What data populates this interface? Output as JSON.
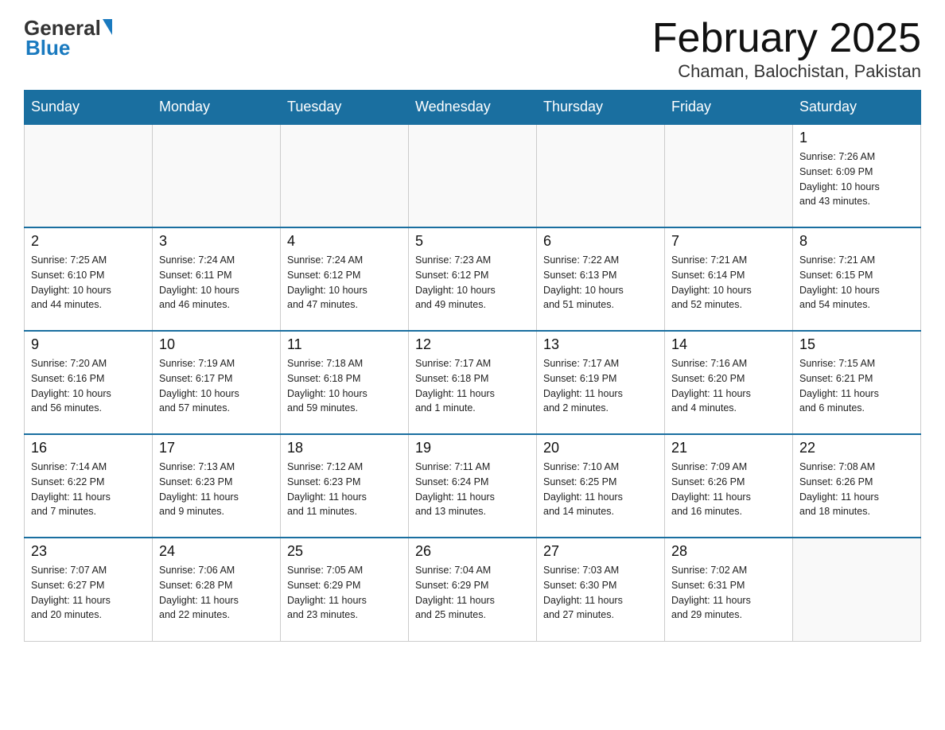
{
  "logo": {
    "text_general": "General",
    "text_blue": "Blue"
  },
  "title": {
    "month_year": "February 2025",
    "location": "Chaman, Balochistan, Pakistan"
  },
  "days_of_week": [
    "Sunday",
    "Monday",
    "Tuesday",
    "Wednesday",
    "Thursday",
    "Friday",
    "Saturday"
  ],
  "weeks": [
    [
      {
        "day": "",
        "info": "",
        "empty": true
      },
      {
        "day": "",
        "info": "",
        "empty": true
      },
      {
        "day": "",
        "info": "",
        "empty": true
      },
      {
        "day": "",
        "info": "",
        "empty": true
      },
      {
        "day": "",
        "info": "",
        "empty": true
      },
      {
        "day": "",
        "info": "",
        "empty": true
      },
      {
        "day": "1",
        "info": "Sunrise: 7:26 AM\nSunset: 6:09 PM\nDaylight: 10 hours\nand 43 minutes."
      }
    ],
    [
      {
        "day": "2",
        "info": "Sunrise: 7:25 AM\nSunset: 6:10 PM\nDaylight: 10 hours\nand 44 minutes."
      },
      {
        "day": "3",
        "info": "Sunrise: 7:24 AM\nSunset: 6:11 PM\nDaylight: 10 hours\nand 46 minutes."
      },
      {
        "day": "4",
        "info": "Sunrise: 7:24 AM\nSunset: 6:12 PM\nDaylight: 10 hours\nand 47 minutes."
      },
      {
        "day": "5",
        "info": "Sunrise: 7:23 AM\nSunset: 6:12 PM\nDaylight: 10 hours\nand 49 minutes."
      },
      {
        "day": "6",
        "info": "Sunrise: 7:22 AM\nSunset: 6:13 PM\nDaylight: 10 hours\nand 51 minutes."
      },
      {
        "day": "7",
        "info": "Sunrise: 7:21 AM\nSunset: 6:14 PM\nDaylight: 10 hours\nand 52 minutes."
      },
      {
        "day": "8",
        "info": "Sunrise: 7:21 AM\nSunset: 6:15 PM\nDaylight: 10 hours\nand 54 minutes."
      }
    ],
    [
      {
        "day": "9",
        "info": "Sunrise: 7:20 AM\nSunset: 6:16 PM\nDaylight: 10 hours\nand 56 minutes."
      },
      {
        "day": "10",
        "info": "Sunrise: 7:19 AM\nSunset: 6:17 PM\nDaylight: 10 hours\nand 57 minutes."
      },
      {
        "day": "11",
        "info": "Sunrise: 7:18 AM\nSunset: 6:18 PM\nDaylight: 10 hours\nand 59 minutes."
      },
      {
        "day": "12",
        "info": "Sunrise: 7:17 AM\nSunset: 6:18 PM\nDaylight: 11 hours\nand 1 minute."
      },
      {
        "day": "13",
        "info": "Sunrise: 7:17 AM\nSunset: 6:19 PM\nDaylight: 11 hours\nand 2 minutes."
      },
      {
        "day": "14",
        "info": "Sunrise: 7:16 AM\nSunset: 6:20 PM\nDaylight: 11 hours\nand 4 minutes."
      },
      {
        "day": "15",
        "info": "Sunrise: 7:15 AM\nSunset: 6:21 PM\nDaylight: 11 hours\nand 6 minutes."
      }
    ],
    [
      {
        "day": "16",
        "info": "Sunrise: 7:14 AM\nSunset: 6:22 PM\nDaylight: 11 hours\nand 7 minutes."
      },
      {
        "day": "17",
        "info": "Sunrise: 7:13 AM\nSunset: 6:23 PM\nDaylight: 11 hours\nand 9 minutes."
      },
      {
        "day": "18",
        "info": "Sunrise: 7:12 AM\nSunset: 6:23 PM\nDaylight: 11 hours\nand 11 minutes."
      },
      {
        "day": "19",
        "info": "Sunrise: 7:11 AM\nSunset: 6:24 PM\nDaylight: 11 hours\nand 13 minutes."
      },
      {
        "day": "20",
        "info": "Sunrise: 7:10 AM\nSunset: 6:25 PM\nDaylight: 11 hours\nand 14 minutes."
      },
      {
        "day": "21",
        "info": "Sunrise: 7:09 AM\nSunset: 6:26 PM\nDaylight: 11 hours\nand 16 minutes."
      },
      {
        "day": "22",
        "info": "Sunrise: 7:08 AM\nSunset: 6:26 PM\nDaylight: 11 hours\nand 18 minutes."
      }
    ],
    [
      {
        "day": "23",
        "info": "Sunrise: 7:07 AM\nSunset: 6:27 PM\nDaylight: 11 hours\nand 20 minutes."
      },
      {
        "day": "24",
        "info": "Sunrise: 7:06 AM\nSunset: 6:28 PM\nDaylight: 11 hours\nand 22 minutes."
      },
      {
        "day": "25",
        "info": "Sunrise: 7:05 AM\nSunset: 6:29 PM\nDaylight: 11 hours\nand 23 minutes."
      },
      {
        "day": "26",
        "info": "Sunrise: 7:04 AM\nSunset: 6:29 PM\nDaylight: 11 hours\nand 25 minutes."
      },
      {
        "day": "27",
        "info": "Sunrise: 7:03 AM\nSunset: 6:30 PM\nDaylight: 11 hours\nand 27 minutes."
      },
      {
        "day": "28",
        "info": "Sunrise: 7:02 AM\nSunset: 6:31 PM\nDaylight: 11 hours\nand 29 minutes."
      },
      {
        "day": "",
        "info": "",
        "empty": true
      }
    ]
  ]
}
